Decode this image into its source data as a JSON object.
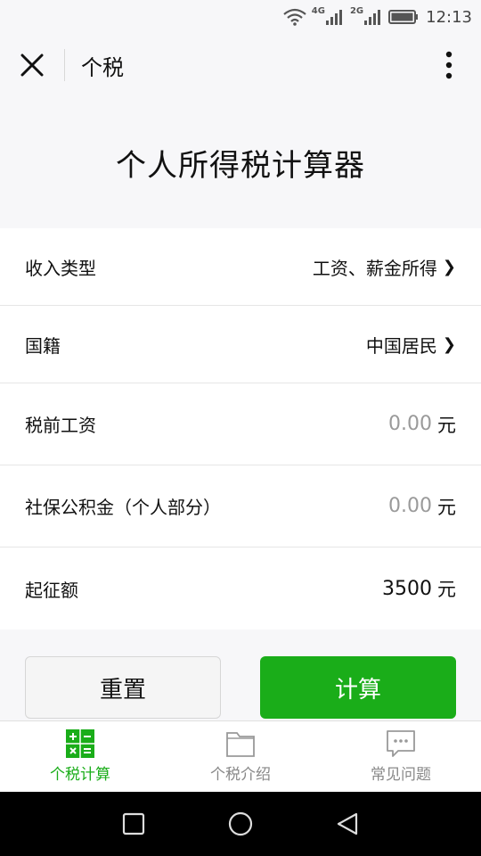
{
  "status_bar": {
    "net1": "4G",
    "net2": "2G",
    "time": "12:13"
  },
  "nav": {
    "title": "个税"
  },
  "heading": "个人所得税计算器",
  "form": {
    "income_type": {
      "label": "收入类型",
      "value": "工资、薪金所得"
    },
    "nationality": {
      "label": "国籍",
      "value": "中国居民"
    },
    "pretax_salary": {
      "label": "税前工资",
      "value": "0.00",
      "unit": "元"
    },
    "social_insurance": {
      "label": "社保公积金（个人部分）",
      "value": "0.00",
      "unit": "元"
    },
    "threshold": {
      "label": "起征额",
      "value": "3500",
      "unit": "元"
    }
  },
  "buttons": {
    "reset": "重置",
    "calculate": "计算"
  },
  "tabs": [
    {
      "label": "个税计算",
      "icon": "calculator-icon",
      "active": true
    },
    {
      "label": "个税介绍",
      "icon": "folder-icon",
      "active": false
    },
    {
      "label": "常见问题",
      "icon": "chat-bubble-icon",
      "active": false
    }
  ],
  "colors": {
    "accent": "#1aad19",
    "tab_inactive": "#888888",
    "placeholder": "#9a9a9a"
  }
}
